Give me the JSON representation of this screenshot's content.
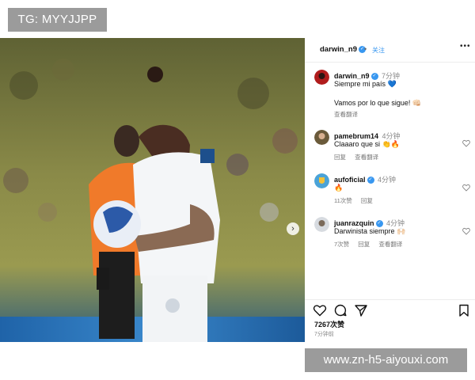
{
  "watermarks": {
    "top": "TG: MYYJJPP",
    "bottom": "www.zn-h5-aiyouxi.com"
  },
  "post": {
    "username": "darwin_n9",
    "separator": "•",
    "follow_label": "关注",
    "more_icon": "more-horizontal-icon",
    "likes": "7267次赞",
    "time_ago": "7分钟前"
  },
  "comments": [
    {
      "username": "darwin_n9",
      "verified": true,
      "time": "7分钟",
      "lines": [
        "Siempre mi país 💙",
        "Vamos por lo que sigue! 👊🏻"
      ],
      "meta": [
        "查看翻译"
      ]
    },
    {
      "username": "pamebrum14",
      "verified": false,
      "time": "4分钟",
      "lines": [
        "Claaaro que si 👏🔥"
      ],
      "meta": [
        "回复",
        "查看翻译"
      ]
    },
    {
      "username": "aufoficial",
      "verified": true,
      "time": "4分钟",
      "lines": [
        "🔥"
      ],
      "meta": [
        "11次赞",
        "回复"
      ]
    },
    {
      "username": "juanrazquin",
      "verified": true,
      "time": "4分钟",
      "lines": [
        "Darwinista siempre 🙌🏻"
      ],
      "meta": [
        "7次赞",
        "回复",
        "查看翻译"
      ]
    }
  ],
  "colors": {
    "accent": "#3897f0",
    "watermark_bg": "#9b9b9b",
    "jersey_orange": "#f07a2a"
  }
}
